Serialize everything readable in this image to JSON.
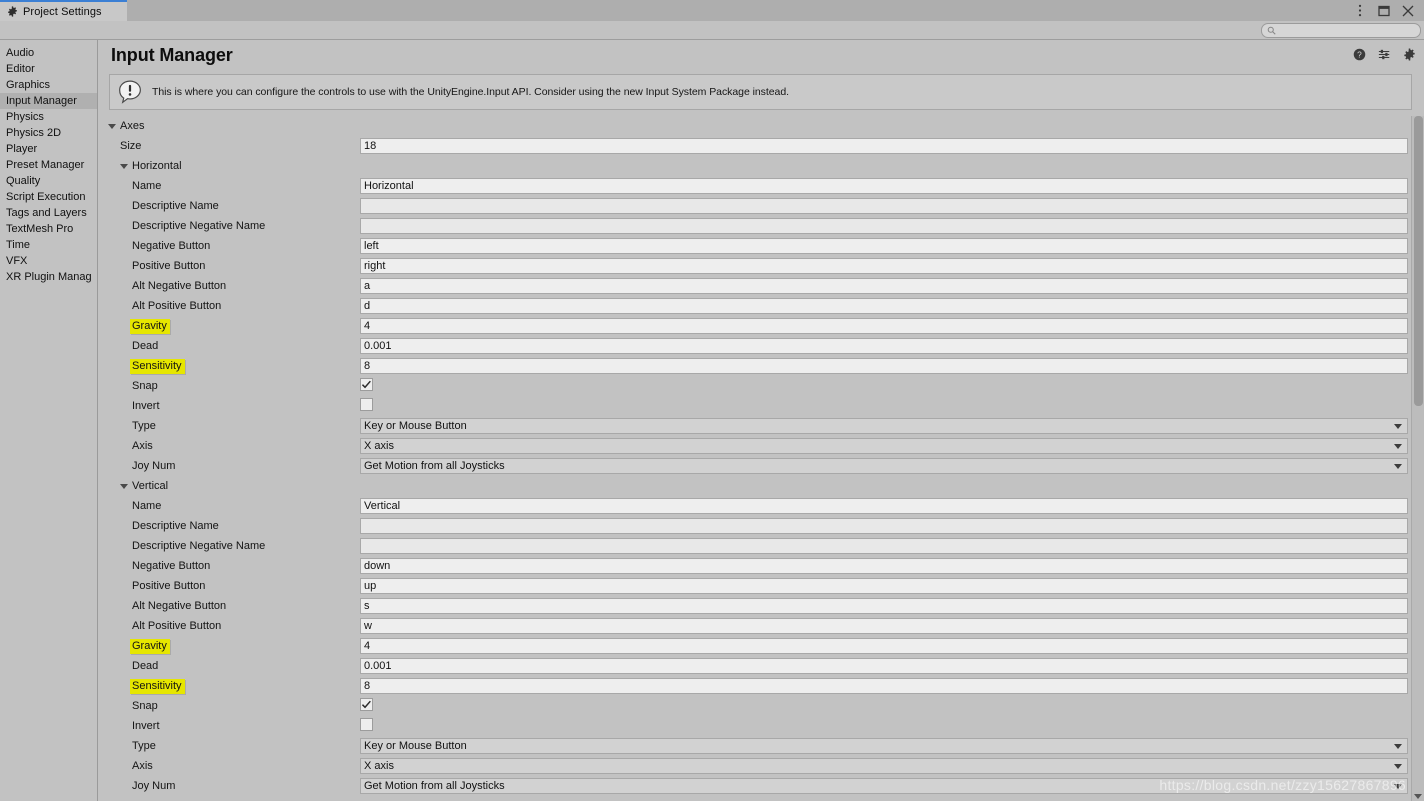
{
  "window": {
    "tab_label": "Project Settings",
    "tab_icon": "gear-icon",
    "controls": [
      {
        "name": "more-options-icon",
        "glyph": "kebab"
      },
      {
        "name": "maximize-icon",
        "glyph": "square"
      },
      {
        "name": "close-icon",
        "glyph": "x"
      }
    ]
  },
  "search": {
    "placeholder": "",
    "value": "",
    "icon": "search-icon"
  },
  "sidebar": {
    "items": [
      {
        "label": "Audio",
        "selected": false
      },
      {
        "label": "Editor",
        "selected": false
      },
      {
        "label": "Graphics",
        "selected": false
      },
      {
        "label": "Input Manager",
        "selected": true
      },
      {
        "label": "Physics",
        "selected": false
      },
      {
        "label": "Physics 2D",
        "selected": false
      },
      {
        "label": "Player",
        "selected": false
      },
      {
        "label": "Preset Manager",
        "selected": false
      },
      {
        "label": "Quality",
        "selected": false
      },
      {
        "label": "Script Execution",
        "selected": false
      },
      {
        "label": "Tags and Layers",
        "selected": false
      },
      {
        "label": "TextMesh Pro",
        "selected": false
      },
      {
        "label": "Time",
        "selected": false
      },
      {
        "label": "VFX",
        "selected": false
      },
      {
        "label": "XR Plugin Manag",
        "selected": false
      }
    ]
  },
  "header": {
    "title": "Input Manager",
    "icons": [
      {
        "name": "help-icon"
      },
      {
        "name": "preset-icon"
      },
      {
        "name": "settings-gear-icon"
      }
    ]
  },
  "helpbox": {
    "icon": "info-bubble-icon",
    "text": "This is where you can configure the controls to use with the UnityEngine.Input API. Consider using the new Input System Package instead."
  },
  "tree": {
    "root_label": "Axes",
    "rows": [
      {
        "kind": "foldout",
        "level": 0,
        "label": "Axes"
      },
      {
        "kind": "text",
        "level": 1,
        "label": "Size",
        "value": "18"
      },
      {
        "kind": "foldout",
        "level": 1,
        "label": "Horizontal"
      },
      {
        "kind": "text",
        "level": 2,
        "label": "Name",
        "value": "Horizontal"
      },
      {
        "kind": "text",
        "level": 2,
        "label": "Descriptive Name",
        "value": ""
      },
      {
        "kind": "text",
        "level": 2,
        "label": "Descriptive Negative Name",
        "value": ""
      },
      {
        "kind": "text",
        "level": 2,
        "label": "Negative Button",
        "value": "left"
      },
      {
        "kind": "text",
        "level": 2,
        "label": "Positive Button",
        "value": "right"
      },
      {
        "kind": "text",
        "level": 2,
        "label": "Alt Negative Button",
        "value": "a"
      },
      {
        "kind": "text",
        "level": 2,
        "label": "Alt Positive Button",
        "value": "d"
      },
      {
        "kind": "text",
        "level": 2,
        "label": "Gravity",
        "value": "4",
        "highlight": true
      },
      {
        "kind": "text",
        "level": 2,
        "label": "Dead",
        "value": "0.001"
      },
      {
        "kind": "text",
        "level": 2,
        "label": "Sensitivity",
        "value": "8",
        "highlight": true
      },
      {
        "kind": "check",
        "level": 2,
        "label": "Snap",
        "checked": true
      },
      {
        "kind": "check",
        "level": 2,
        "label": "Invert",
        "checked": false
      },
      {
        "kind": "popup",
        "level": 2,
        "label": "Type",
        "value": "Key or Mouse Button"
      },
      {
        "kind": "popup",
        "level": 2,
        "label": "Axis",
        "value": "X axis"
      },
      {
        "kind": "popup",
        "level": 2,
        "label": "Joy Num",
        "value": "Get Motion from all Joysticks"
      },
      {
        "kind": "foldout",
        "level": 1,
        "label": "Vertical"
      },
      {
        "kind": "text",
        "level": 2,
        "label": "Name",
        "value": "Vertical"
      },
      {
        "kind": "text",
        "level": 2,
        "label": "Descriptive Name",
        "value": ""
      },
      {
        "kind": "text",
        "level": 2,
        "label": "Descriptive Negative Name",
        "value": ""
      },
      {
        "kind": "text",
        "level": 2,
        "label": "Negative Button",
        "value": "down"
      },
      {
        "kind": "text",
        "level": 2,
        "label": "Positive Button",
        "value": "up"
      },
      {
        "kind": "text",
        "level": 2,
        "label": "Alt Negative Button",
        "value": "s"
      },
      {
        "kind": "text",
        "level": 2,
        "label": "Alt Positive Button",
        "value": "w"
      },
      {
        "kind": "text",
        "level": 2,
        "label": "Gravity",
        "value": "4",
        "highlight": true
      },
      {
        "kind": "text",
        "level": 2,
        "label": "Dead",
        "value": "0.001"
      },
      {
        "kind": "text",
        "level": 2,
        "label": "Sensitivity",
        "value": "8",
        "highlight": true
      },
      {
        "kind": "check",
        "level": 2,
        "label": "Snap",
        "checked": true
      },
      {
        "kind": "check",
        "level": 2,
        "label": "Invert",
        "checked": false
      },
      {
        "kind": "popup",
        "level": 2,
        "label": "Type",
        "value": "Key or Mouse Button"
      },
      {
        "kind": "popup",
        "level": 2,
        "label": "Axis",
        "value": "X axis"
      },
      {
        "kind": "popup",
        "level": 2,
        "label": "Joy Num",
        "value": "Get Motion from all Joysticks"
      }
    ]
  },
  "watermark": {
    "text": "https://blog.csdn.net/zzy15627867896"
  },
  "colors": {
    "window_bg": "#c2c2c2",
    "tabbar_bg": "#aeaeae",
    "tab_active_bg": "#c8c8c8",
    "tab_accent": "#3b7fd4",
    "field_bg": "#eeeeee",
    "popup_bg": "#d2d2d2",
    "selection_bg": "#b0b0b0",
    "highlight_yellow": "#e6e600",
    "helpbox_bg": "#c9c9c9"
  }
}
